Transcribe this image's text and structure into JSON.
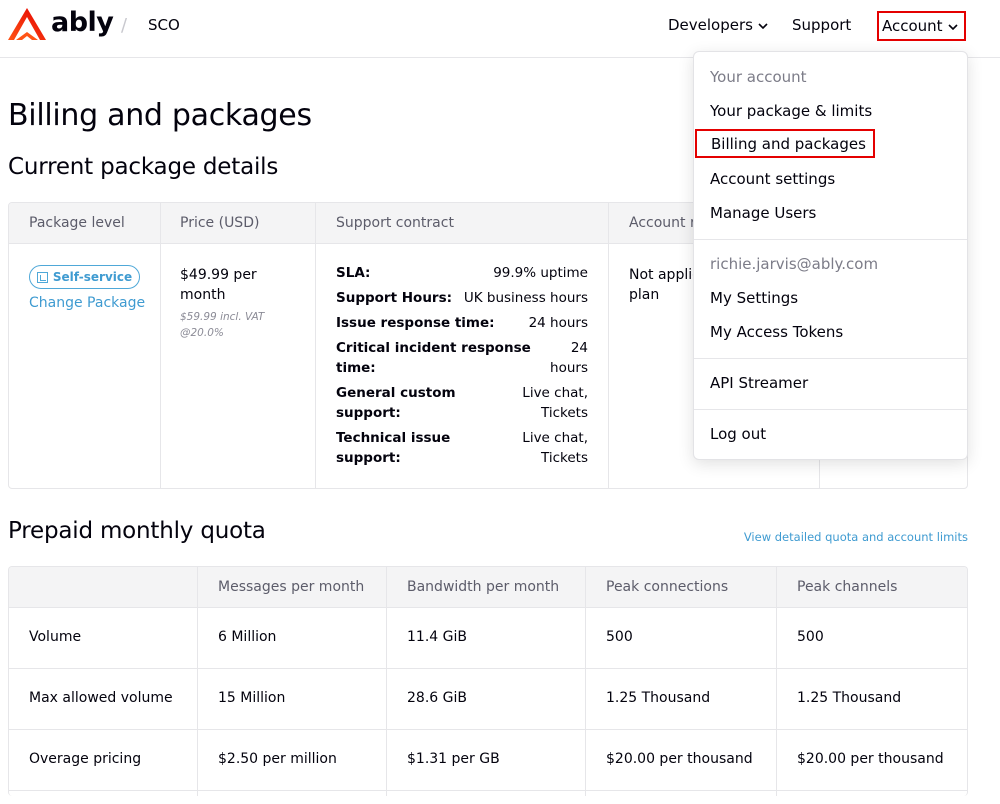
{
  "brand": {
    "logo_text": "ably",
    "accent_color": "#ff5416"
  },
  "header": {
    "app_name": "SCO",
    "separator": "/",
    "nav": {
      "developers": "Developers",
      "support": "Support",
      "account": "Account"
    }
  },
  "page": {
    "title": "Billing and packages",
    "current_section_title": "Current package details",
    "quota_section_title": "Prepaid monthly quota",
    "quota_link": "View detailed quota and account limits"
  },
  "package_table": {
    "headers": {
      "level": "Package level",
      "price": "Price (USD)",
      "support": "Support contract",
      "account": "Account r"
    },
    "badge": "Self-service",
    "change_link": "Change Package",
    "price_line1": "$49.99 per",
    "price_line2": "month",
    "vat_line1": "$59.99 incl. VAT",
    "vat_line2": "@20.0%",
    "support_rows": [
      {
        "k1": "SLA:",
        "k2": "",
        "v1": "99.9% uptime",
        "v2": ""
      },
      {
        "k1": "Support Hours:",
        "k2": "",
        "v1": "UK business hours",
        "v2": ""
      },
      {
        "k1": "Issue response time:",
        "k2": "",
        "v1": "24 hours",
        "v2": ""
      },
      {
        "k1": "Critical incident response",
        "k2": "time:",
        "v1": "24",
        "v2": "hours"
      },
      {
        "k1": "General custom",
        "k2": "support:",
        "v1": "Live chat,",
        "v2": "Tickets"
      },
      {
        "k1": "Technical issue",
        "k2": "support:",
        "v1": "Live chat,",
        "v2": "Tickets"
      }
    ],
    "account_value_line1": "Not applic",
    "account_value_line2": "plan"
  },
  "quota_table": {
    "headers": [
      "",
      "Messages per month",
      "Bandwidth per month",
      "Peak connections",
      "Peak channels"
    ],
    "rows": [
      [
        "Volume",
        "6 Million",
        "11.4 GiB",
        "500",
        "500"
      ],
      [
        "Max allowed volume",
        "15 Million",
        "28.6 GiB",
        "1.25 Thousand",
        "1.25 Thousand"
      ],
      [
        "Overage pricing",
        "$2.50 per million",
        "$1.31 per GB",
        "$20.00 per thousand",
        "$20.00 per thousand"
      ]
    ]
  },
  "account_menu": {
    "section_label": "Your account",
    "items": [
      "Your package & limits",
      "Billing and packages",
      "Account settings",
      "Manage Users"
    ],
    "user_email": "richie.jarvis@ably.com",
    "user_items": [
      "My Settings",
      "My Access Tokens"
    ],
    "api_streamer": "API Streamer",
    "logout": "Log out"
  }
}
